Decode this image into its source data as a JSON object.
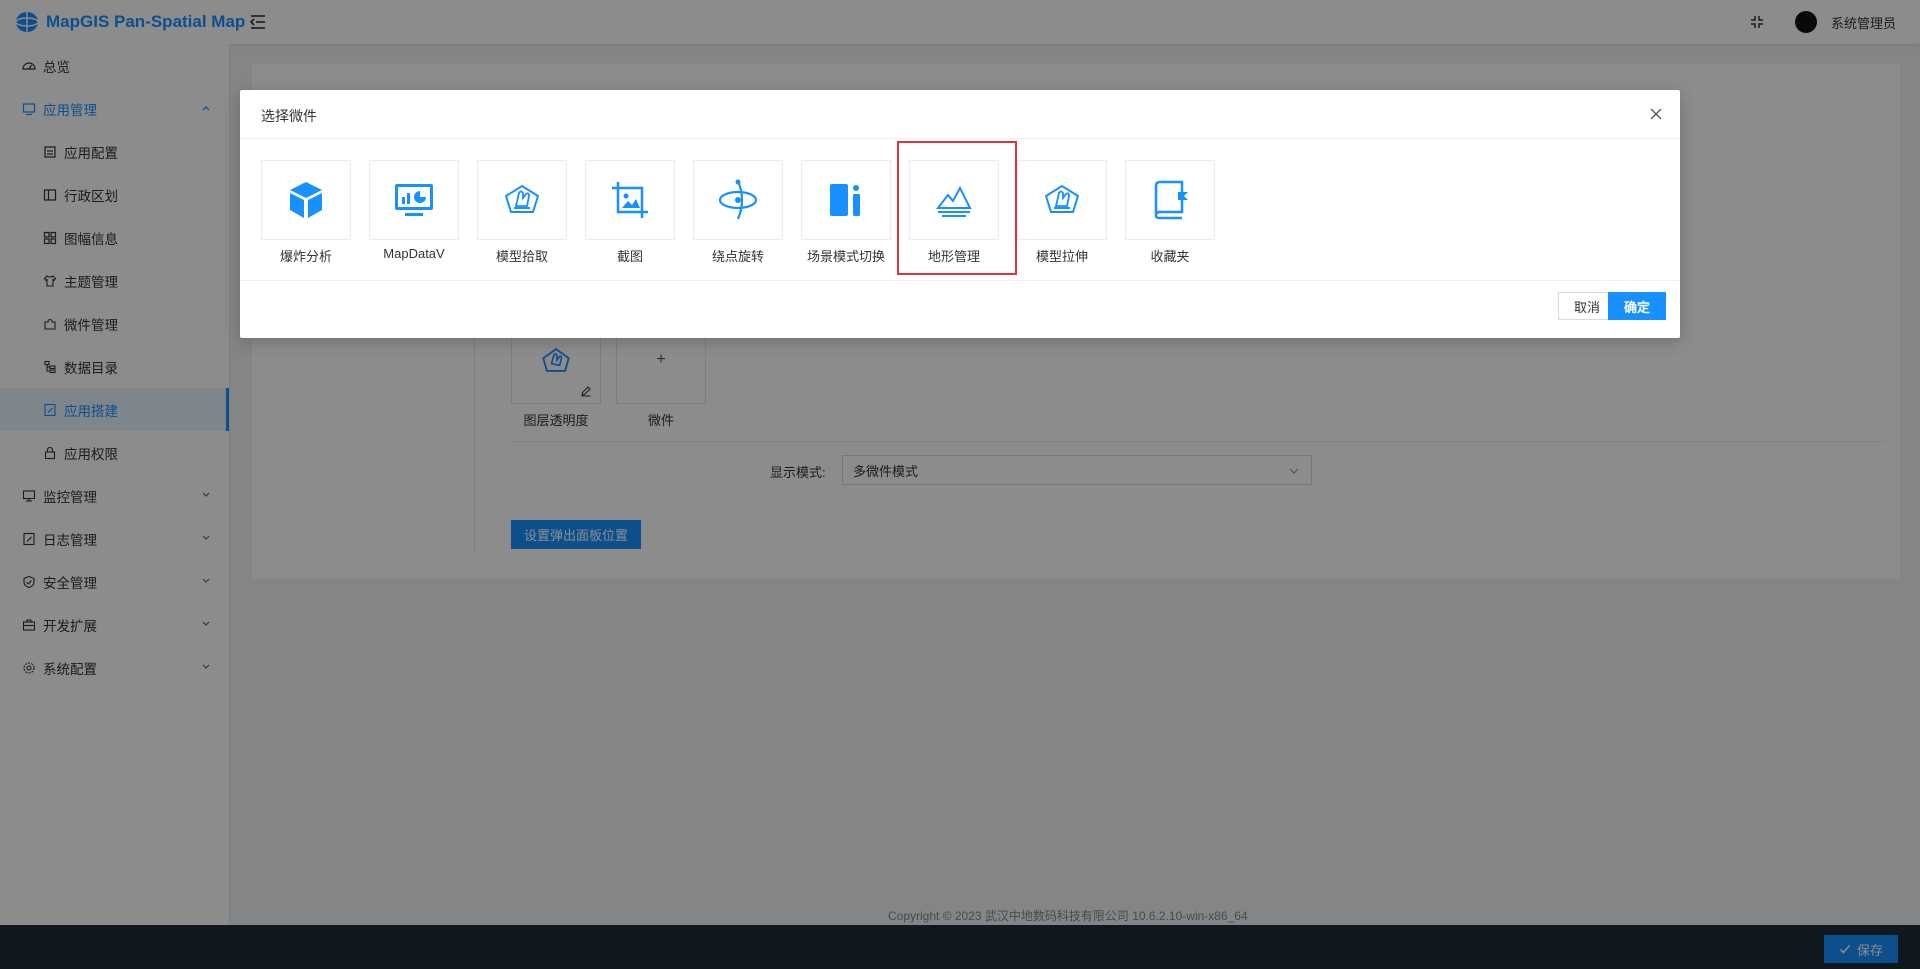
{
  "app": {
    "title": "MapGIS Pan-Spatial Map"
  },
  "header": {
    "user_name": "系统管理员"
  },
  "sidebar": {
    "items": [
      {
        "label": "总览"
      },
      {
        "label": "应用管理"
      },
      {
        "label": "应用配置"
      },
      {
        "label": "行政区划"
      },
      {
        "label": "图幅信息"
      },
      {
        "label": "主题管理"
      },
      {
        "label": "微件管理"
      },
      {
        "label": "数据目录"
      },
      {
        "label": "应用搭建"
      },
      {
        "label": "应用权限"
      },
      {
        "label": "监控管理"
      },
      {
        "label": "日志管理"
      },
      {
        "label": "安全管理"
      },
      {
        "label": "开发扩展"
      },
      {
        "label": "系统配置"
      }
    ]
  },
  "main": {
    "slots": [
      {
        "label": "图层透明度"
      },
      {
        "label": "微件",
        "plus": "+"
      }
    ],
    "mode_label": "显示模式:",
    "mode_value": "多微件模式",
    "panel_position_button": "设置弹出面板位置"
  },
  "footer": {
    "copyright": "Copyright © 2023 武汉中地数码科技有限公司 10.6.2.10-win-x86_64"
  },
  "bottom_bar": {
    "save_label": "保存"
  },
  "modal": {
    "title": "选择微件",
    "widgets": [
      {
        "label": "爆炸分析",
        "icon": "cube-icon"
      },
      {
        "label": "MapDataV",
        "icon": "dashboard-monitor-icon"
      },
      {
        "label": "模型拾取",
        "icon": "hand-pick-icon"
      },
      {
        "label": "截图",
        "icon": "crop-image-icon"
      },
      {
        "label": "绕点旋转",
        "icon": "orbit-rotate-icon"
      },
      {
        "label": "场景模式切换",
        "icon": "scene-switch-icon"
      },
      {
        "label": "地形管理",
        "icon": "terrain-icon"
      },
      {
        "label": "模型拉伸",
        "icon": "model-stretch-icon"
      },
      {
        "label": "收藏夹",
        "icon": "bookmark-book-icon"
      }
    ],
    "cancel_label": "取消",
    "ok_label": "确定"
  },
  "colors": {
    "accent": "#1890ff",
    "highlight": "#d9363e",
    "bottom_bar": "#1f2a3a"
  }
}
